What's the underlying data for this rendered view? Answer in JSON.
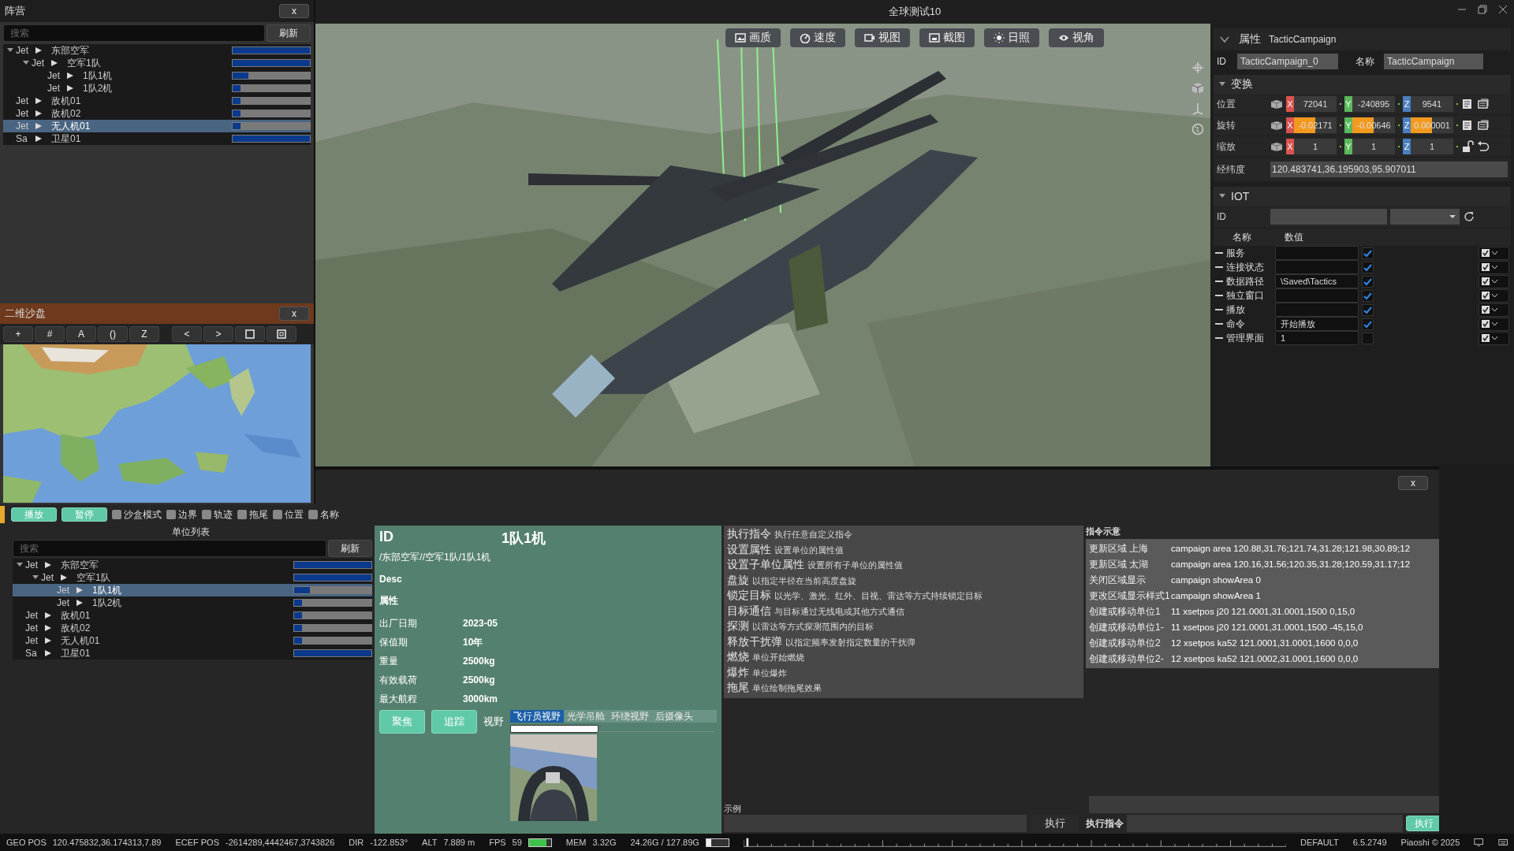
{
  "window": {
    "title": "全球测试10"
  },
  "faction_panel": {
    "title": "阵营",
    "close": "x",
    "search": {
      "placeholder": "搜索"
    },
    "refresh": "刷新",
    "tree": [
      {
        "type": "Jet",
        "name": "东部空军",
        "level": 1,
        "selected": false,
        "expanded": true,
        "children": [
          {
            "type": "Jet",
            "name": "空军1队",
            "level": 1,
            "selected": false,
            "expanded": true,
            "children": [
              {
                "type": "Jet",
                "name": "1队1机",
                "level": 0.2,
                "selected": false
              },
              {
                "type": "Jet",
                "name": "1队2机",
                "level": 0.1,
                "selected": false
              }
            ]
          }
        ]
      },
      {
        "type": "Jet",
        "name": "敌机01",
        "level": 0.1,
        "selected": false
      },
      {
        "type": "Jet",
        "name": "敌机02",
        "level": 0.1,
        "selected": false
      },
      {
        "type": "Jet",
        "name": "无人机01",
        "level": 0.1,
        "selected": true
      },
      {
        "type": "Sa",
        "name": "卫星01",
        "level": 1,
        "selected": false
      }
    ]
  },
  "map_panel": {
    "title": "二维沙盘",
    "close": "x",
    "tools": [
      {
        "label": "+"
      },
      {
        "label": "#"
      },
      {
        "label": "A"
      },
      {
        "label": "()"
      },
      {
        "label": "Z"
      },
      {
        "label": "<"
      },
      {
        "label": ">"
      }
    ]
  },
  "viewport": {
    "tools": [
      {
        "label": "画质"
      },
      {
        "label": "速度"
      },
      {
        "label": "视图"
      },
      {
        "label": "截图"
      },
      {
        "label": "日照"
      },
      {
        "label": "视角"
      }
    ]
  },
  "properties": {
    "title": "属性",
    "object": "TacticCampaign",
    "id_label": "ID",
    "id_value": "TacticCampaign_0",
    "name_label": "名称",
    "name_value": "TacticCampaign",
    "transform": {
      "title": "变换",
      "expanded": true,
      "rows": [
        {
          "label": "位置",
          "kind": "copy",
          "axes": [
            {
              "axis": "X",
              "value": "72041"
            },
            {
              "axis": "Y",
              "value": "-240895"
            },
            {
              "axis": "Z",
              "value": "9541"
            }
          ]
        },
        {
          "label": "旋转",
          "kind": "copy",
          "axes": [
            {
              "axis": "X",
              "value": "-0.02171",
              "level": 0.58
            },
            {
              "axis": "Y",
              "value": "-0.00646",
              "level": 0.58
            },
            {
              "axis": "Z",
              "value": "0.000001",
              "level": 0.58
            }
          ]
        },
        {
          "label": "缩放",
          "kind": "lock",
          "axes": [
            {
              "axis": "X",
              "value": "1"
            },
            {
              "axis": "Y",
              "value": "1"
            },
            {
              "axis": "Z",
              "value": "1"
            }
          ]
        }
      ],
      "geo_label": "经纬度",
      "geo_value": "120.483741,36.195903,95.907011"
    },
    "iot": {
      "title": "IOT",
      "expanded": true,
      "id_label": "ID",
      "col_name": "名称",
      "col_value": "数值",
      "rows": [
        {
          "name": "服务",
          "checked": true,
          "option_checked": true
        },
        {
          "name": "连接状态",
          "checked": true,
          "option_checked": true
        },
        {
          "name": "数据路径",
          "value": "\\Saved\\Tactics",
          "checked": true,
          "option_checked": true
        },
        {
          "name": "独立窗口",
          "checked": true,
          "option_checked": true
        },
        {
          "name": "播放",
          "checked": true,
          "option_checked": true
        },
        {
          "name": "命令",
          "value": "开始播放",
          "checked": true,
          "option_checked": true
        },
        {
          "name": "管理界面",
          "value": "1",
          "checked": false,
          "option_checked": true
        }
      ]
    }
  },
  "bottom_panel": {
    "close": "x",
    "buttons": [
      "播放",
      "暂停"
    ],
    "toggles": [
      {
        "label": "沙盒模式",
        "checked": false
      },
      {
        "label": "边界",
        "checked": false
      },
      {
        "label": "轨迹",
        "checked": false
      },
      {
        "label": "拖尾",
        "checked": false
      },
      {
        "label": "位置",
        "checked": false
      },
      {
        "label": "名称",
        "checked": false
      }
    ],
    "unit_list": {
      "title": "单位列表",
      "search": {
        "placeholder": "搜索"
      },
      "refresh": "刷新",
      "tree": [
        {
          "type": "Jet",
          "name": "东部空军",
          "level": 1,
          "selected": false,
          "expanded": true,
          "children": [
            {
              "type": "Jet",
              "name": "空军1队",
              "level": 1,
              "selected": false,
              "expanded": true,
              "children": [
                {
                  "type": "Jet",
                  "name": "1队1机",
                  "level": 0.2,
                  "selected": true
                },
                {
                  "type": "Jet",
                  "name": "1队2机",
                  "level": 0.1,
                  "selected": false
                }
              ]
            }
          ]
        },
        {
          "type": "Jet",
          "name": "敌机01",
          "level": 0.1,
          "selected": false
        },
        {
          "type": "Jet",
          "name": "敌机02",
          "level": 0.1,
          "selected": false
        },
        {
          "type": "Jet",
          "name": "无人机01",
          "level": 0.1,
          "selected": false
        },
        {
          "type": "Sa",
          "name": "卫星01",
          "level": 1,
          "selected": false
        }
      ]
    },
    "info": {
      "id_label": "ID",
      "name": "1队1机",
      "path": "/东部空军//空军1队/1队1机",
      "desc": "Desc",
      "attrs_title": "属性",
      "attrs": [
        {
          "key": "出厂日期",
          "value": "2023-05"
        },
        {
          "key": "保值期",
          "value": "10年"
        },
        {
          "key": "重量",
          "value": "2500kg"
        },
        {
          "key": "有效载荷",
          "value": "2500kg"
        },
        {
          "key": "最大航程",
          "value": "3000km"
        }
      ],
      "buttons": [
        "聚焦",
        "追踪"
      ],
      "view_label": "视野",
      "view_tabs": [
        {
          "label": "飞行员视野",
          "selected": true
        },
        {
          "label": "光学吊舱",
          "selected": false
        },
        {
          "label": "环绕视野",
          "selected": false
        },
        {
          "label": "后摄像头",
          "selected": false
        }
      ],
      "view_progress": {
        "level": 0.43
      }
    },
    "commands": [
      {
        "name": "执行指令",
        "desc": "执行任意自定义指令"
      },
      {
        "name": "设置属性",
        "desc": "设置单位的属性值"
      },
      {
        "name": "设置子单位属性",
        "desc": "设置所有子单位的属性值"
      },
      {
        "name": "盘旋",
        "desc": "以指定半径在当前高度盘旋"
      },
      {
        "name": "锁定目标",
        "desc": "以光学、激光、红外、目视、雷达等方式持续锁定目标"
      },
      {
        "name": "目标通信",
        "desc": "与目标通过无线电或其他方式通信"
      },
      {
        "name": "探测",
        "desc": "以雷达等方式探测范围内的目标"
      },
      {
        "name": "释放干扰弹",
        "desc": "以指定频率发射指定数量的干扰弹"
      },
      {
        "name": "燃烧",
        "desc": "单位开始燃烧"
      },
      {
        "name": "爆炸",
        "desc": "单位爆炸"
      },
      {
        "name": "拖尾",
        "desc": "单位绘制拖尾效果"
      }
    ],
    "example": {
      "label": "示例",
      "run": "执行"
    },
    "command_examples": {
      "title": "指令示意",
      "rows": [
        {
          "name": "更新区域 上海",
          "command": "campaign area 120.88,31.76;121.74,31.28;121.98,30.89;12"
        },
        {
          "name": "更新区域 太湖",
          "command": "campaign area 120.16,31.56;120.35,31.28;120.59,31.17;12"
        },
        {
          "name": "关闭区域显示",
          "command": "campaign showArea 0"
        },
        {
          "name": "更改区域显示样式1",
          "command": "campaign showArea 1"
        },
        {
          "name": "创建或移动单位1",
          "command": "11 xsetpos j20 121.0001,31.0001,1500 0,15,0"
        },
        {
          "name": "创建或移动单位1-",
          "command": "11 xsetpos j20 121.0001,31.0001,1500 -45,15,0"
        },
        {
          "name": "创建或移动单位2",
          "command": "12 xsetpos ka52 121.0001,31.0001,1600 0,0,0"
        },
        {
          "name": "创建或移动单位2-",
          "command": "12 xsetpos ka52 121.0002,31.0001,1600 0,0,0"
        }
      ],
      "exec_label": "执行指令",
      "run": "执行"
    }
  },
  "status_bar": {
    "items": [
      {
        "label": "GEO POS",
        "value": "120.475832,36.174313,7.89"
      },
      {
        "label": "ECEF POS",
        "value": "-2614289,4442467,3743826"
      },
      {
        "label": "DIR",
        "value": "-122.853°"
      },
      {
        "label": "ALT",
        "value": "7.889 m"
      },
      {
        "label": "FPS",
        "value": "59",
        "kind": "fps",
        "level": 0.8
      },
      {
        "label": "MEM",
        "value": "3.32G",
        "kind": "plain"
      },
      {
        "value": "24.26G / 127.89G",
        "kind": "mem",
        "level": 0.2
      }
    ],
    "profile": "DEFAULT",
    "version": "6.5.2749",
    "copyright": "Piaoshi © 2025"
  }
}
